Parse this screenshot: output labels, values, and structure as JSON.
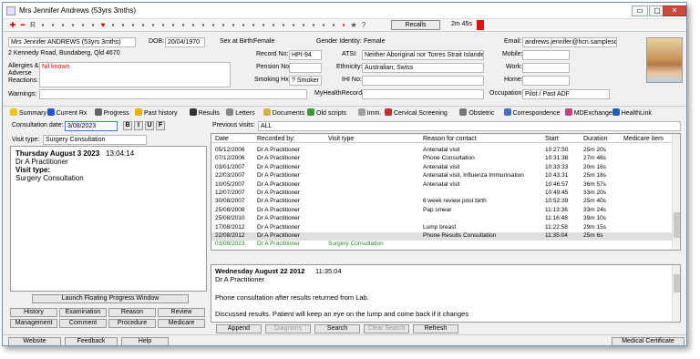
{
  "window": {
    "title": "Mrs Jennifer Andrews (53yrs 3mths)",
    "buttons": {
      "minimize": "▭",
      "maximize": "▢",
      "close": "✕"
    }
  },
  "toolbar": {
    "icons": [
      "add-icon",
      "remove-icon",
      "rx-icon",
      "pill-icon",
      "monitor-icon",
      "calculator-icon",
      "camera-icon",
      "save-icon",
      "scissors-icon",
      "heart-icon",
      "blood-icon",
      "person-icon",
      "lungs-icon",
      "chart-icon",
      "test-tube-icon",
      "flask-icon",
      "scales-icon",
      "wheelchair-icon",
      "baby-icon",
      "sync-icon",
      "world-icon",
      "clock-icon",
      "calendar-icon",
      "arrow-icon",
      "notepad-icon",
      "doctor-icon",
      "mortarboard-icon",
      "car-icon",
      "folder-icon",
      "open-folder-icon",
      "letter-icon",
      "box-icon",
      "globe-icon",
      "power-icon",
      "star-icon",
      "help-icon"
    ],
    "recalls_label": "Recalls",
    "timer": "2m 45s"
  },
  "patient": {
    "name_select": "Mrs Jennifer ANDREWS (53yrs 3mths)",
    "address": "2 Kennedy Road, Bundaberg, Qld  4670",
    "dob_label": "DOB:",
    "dob": "20/04/1970",
    "sex_label": "Sex at Birth:",
    "sex": "Female",
    "gender_label": "Gender Identity:",
    "gender": "Female",
    "email_label": "Email:",
    "email": "andrews.jennifer@hcn.samplesdb.c",
    "record_label": "Record No:",
    "record": "HPI-94",
    "atsi_label": "ATSI:",
    "atsi": "Neither Aboriginal nor Torres Strait Islander",
    "mobile_label": "Mobile:",
    "mobile": "",
    "allergies_label": "Allergies & Adverse Reactions:",
    "allergies": "Nil known",
    "pension_label": "Pension No:",
    "pension": "",
    "ethnicity_label": "Ethnicity:",
    "ethnicity": "Australian; Swiss",
    "work_label": "Work:",
    "work": "",
    "smoking_label": "Smoking Hx:",
    "smoking": "? Smoker",
    "ihi_label": "IHI No:",
    "ihi": "",
    "home_label": "Home:",
    "home": "",
    "warnings_label": "Warnings:",
    "warnings": "",
    "myhr_label": "MyHealthRecord:",
    "myhr": "",
    "occupation_label": "Occupation:",
    "occupation": "Pilot / Past ADF"
  },
  "tabs": [
    {
      "label": "Summary",
      "name": "summary",
      "color": "#f0c419"
    },
    {
      "label": "Current Rx",
      "name": "current-rx",
      "color": "#2255cc"
    },
    {
      "label": "Progress",
      "name": "progress",
      "color": "#666"
    },
    {
      "label": "Past history",
      "name": "past-history",
      "color": "#e8b400"
    },
    {
      "label": "Results",
      "name": "results",
      "color": "#333"
    },
    {
      "label": "Letters",
      "name": "letters",
      "color": "#888"
    },
    {
      "label": "Documents",
      "name": "documents",
      "color": "#d8b040"
    },
    {
      "label": "Old scripts",
      "name": "old-scripts",
      "color": "#3a9a3a"
    },
    {
      "label": "Imm.",
      "name": "imm",
      "color": "#a0a0a0"
    },
    {
      "label": "Cervical Screening",
      "name": "cervical-screening",
      "color": "#c03030"
    },
    {
      "label": "Obstetric",
      "name": "obstetric",
      "color": "#777"
    },
    {
      "label": "Correspondence",
      "name": "correspondence",
      "color": "#4070c0"
    },
    {
      "label": "MDExchange",
      "name": "mdexchange",
      "color": "#c04080"
    },
    {
      "label": "HealthLink",
      "name": "healthlink",
      "color": "#2060b0"
    }
  ],
  "consultation": {
    "date_label": "Consultation date:",
    "date": "3/08/2023",
    "format_buttons": [
      "B",
      "I",
      "U",
      "F"
    ],
    "visit_type_label": "Visit type:",
    "visit_type": "Surgery Consultation",
    "note_date": "Thursday August 3 2023",
    "note_time": "13:04:14",
    "note_doctor": "Dr A Practitioner",
    "note_visit_label": "Visit type:",
    "note_visit": "Surgery Consultation",
    "launch_button": "Launch Floating Progress Window",
    "buttons_row1": [
      "History",
      "Examination",
      "Reason",
      "Review"
    ],
    "buttons_row2": [
      "Management",
      "Comment",
      "Procedure",
      "Medicare"
    ]
  },
  "previous": {
    "label": "Previous visits:",
    "filter": "ALL",
    "headers": [
      "Date",
      "Recorded by:",
      "Visit type",
      "Reason for contact",
      "Start",
      "Duration",
      "Medicare item"
    ],
    "rows": [
      [
        "05/12/2006",
        "Dr A Practitioner",
        "",
        "Antenatal visit",
        "10:27:50",
        "25m 20s",
        ""
      ],
      [
        "07/12/2006",
        "Dr A Practitioner",
        "",
        "Phone Consultation",
        "10:31:38",
        "27m 46s",
        ""
      ],
      [
        "03/01/2007",
        "Dr A Practitioner",
        "",
        "Antenatal visit",
        "10:33:33",
        "20m 16s",
        ""
      ],
      [
        "22/03/2007",
        "Dr A Practitioner",
        "",
        "Antenatal visit, Influenza Immunisation",
        "10:43:31",
        "25m 18s",
        ""
      ],
      [
        "10/05/2007",
        "Dr A Practitioner",
        "",
        "Antenatal visit",
        "10:46:57",
        "36m 57s",
        ""
      ],
      [
        "12/07/2007",
        "Dr A Practitioner",
        "",
        "",
        "10:49:45",
        "33m 20s",
        ""
      ],
      [
        "30/08/2007",
        "Dr A Practitioner",
        "",
        "6 week review post birth",
        "10:52:39",
        "25m 40s",
        ""
      ],
      [
        "25/08/2008",
        "Dr A Practitioner",
        "",
        "Pap smear",
        "11:13:36",
        "33m 24s",
        ""
      ],
      [
        "25/08/2010",
        "Dr A Practitioner",
        "",
        "",
        "11:16:48",
        "39m 10s",
        ""
      ],
      [
        "17/08/2012",
        "Dr A Practitioner",
        "",
        "Lump breast",
        "11:22:58",
        "29m 15s",
        ""
      ],
      [
        "22/08/2012",
        "Dr A Practitioner",
        "",
        "Phone Results Consultation",
        "11:35:04",
        "25m 6s",
        ""
      ],
      [
        "03/08/2023",
        "Dr A Practitioner",
        "Surgery Consultation",
        "",
        "",
        "",
        ""
      ]
    ],
    "note_date": "Wednesday August 22 2012",
    "note_time": "11:35:04",
    "note_doctor": "Dr A Practitioner",
    "note_line1": "Phone consultation after results returned from Lab.",
    "note_line2": "Discussed results.  Patient will keep an eye on the lump and come back if it changes",
    "buttons": [
      "Append",
      "Diagrams",
      "Search",
      "Clear Search",
      "Refresh"
    ]
  },
  "statusbar": {
    "website": "Website",
    "feedback": "Feedback",
    "help": "Help",
    "medical_certificate": "Medical Certificate"
  }
}
